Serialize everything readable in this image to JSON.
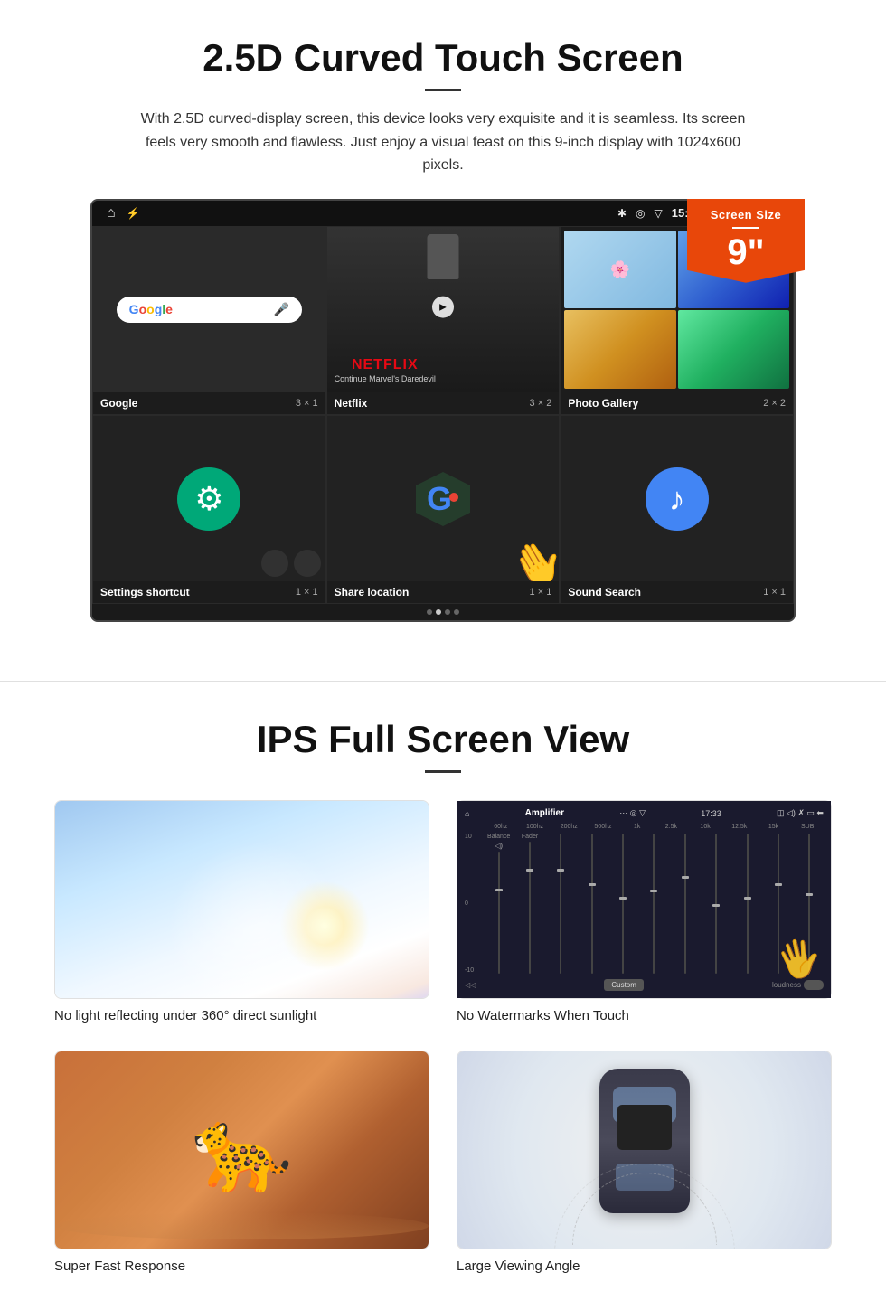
{
  "section1": {
    "title": "2.5D Curved Touch Screen",
    "description": "With 2.5D curved-display screen, this device looks very exquisite and it is seamless. Its screen feels very smooth and flawless. Just enjoy a visual feast on this 9-inch display with 1024x600 pixels.",
    "screen_badge": {
      "title": "Screen Size",
      "size": "9\""
    },
    "status_bar": {
      "time": "15:06"
    },
    "apps": [
      {
        "name": "Google",
        "size": "3 × 1"
      },
      {
        "name": "Netflix",
        "size": "3 × 2"
      },
      {
        "name": "Photo Gallery",
        "size": "2 × 2"
      },
      {
        "name": "Settings shortcut",
        "size": "1 × 1"
      },
      {
        "name": "Share location",
        "size": "1 × 1"
      },
      {
        "name": "Sound Search",
        "size": "1 × 1"
      }
    ],
    "netflix_text": "NETFLIX",
    "netflix_sub": "Continue Marvel's Daredevil"
  },
  "section2": {
    "title": "IPS Full Screen View",
    "features": [
      {
        "caption": "No light reflecting under 360° direct sunlight"
      },
      {
        "caption": "No Watermarks When Touch"
      },
      {
        "caption": "Super Fast Response"
      },
      {
        "caption": "Large Viewing Angle"
      }
    ],
    "amplifier": {
      "title": "Amplifier",
      "time": "17:33",
      "labels": [
        "10",
        "0",
        "-10"
      ],
      "bands": [
        "60hz",
        "100hz",
        "200hz",
        "500hz",
        "1k",
        "2.5k",
        "10k",
        "12.5k",
        "15k",
        "SUB"
      ],
      "custom_btn": "Custom",
      "loudness_label": "loudness"
    }
  }
}
